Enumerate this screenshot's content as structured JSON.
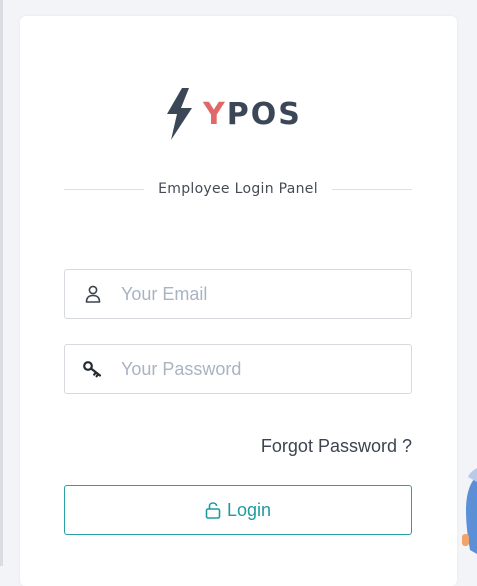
{
  "brand": {
    "name_accent": "Y",
    "name_rest": "POS",
    "logo_icon": "lightning-bolt-icon"
  },
  "panel": {
    "title": "Employee Login Panel"
  },
  "form": {
    "email": {
      "placeholder": "Your Email",
      "value": "",
      "icon": "user-icon"
    },
    "password": {
      "placeholder": "Your Password",
      "value": "",
      "icon": "key-icon"
    },
    "forgot_label": "Forgot Password ?",
    "login_label": "Login",
    "login_icon": "unlock-icon"
  },
  "colors": {
    "accent": "#1f9aa1",
    "brand_dark": "#3b4656",
    "brand_red": "#e06868"
  }
}
